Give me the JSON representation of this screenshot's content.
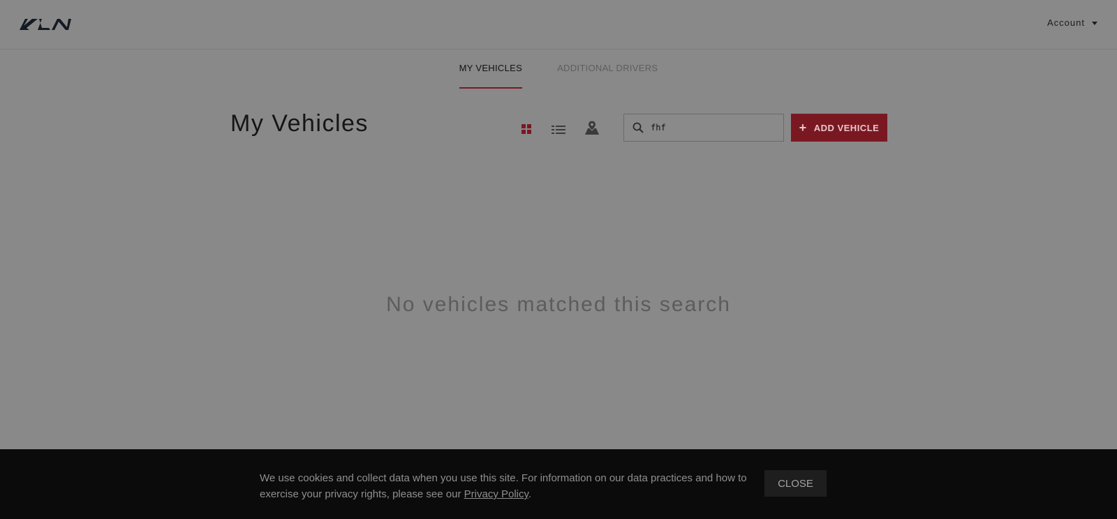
{
  "header": {
    "logo_icon": "kia-logo",
    "account_label": "Account"
  },
  "tabs": [
    {
      "label": "MY VEHICLES",
      "active": true
    },
    {
      "label": "ADDITIONAL DRIVERS",
      "active": false
    }
  ],
  "main": {
    "title": "My Vehicles",
    "view_icons": [
      "grid-view-icon",
      "list-view-icon",
      "map-view-icon"
    ],
    "active_view": "grid",
    "search": {
      "value": "fhf",
      "icon": "search-icon"
    },
    "add_button": {
      "label": "ADD VEHICLE",
      "icon": "plus-icon"
    },
    "empty_message": "No vehicles matched this search"
  },
  "cookie_banner": {
    "text_before": "We use cookies and collect data when you use this site. For information on our data practices and how to exercise your privacy rights, please see our ",
    "link_text": "Privacy Policy",
    "text_after": ".",
    "close_label": "CLOSE"
  },
  "colors": {
    "overlay_bg": "#898989",
    "accent": "#7a1822",
    "cookie_bg": "#0b0b0b"
  }
}
